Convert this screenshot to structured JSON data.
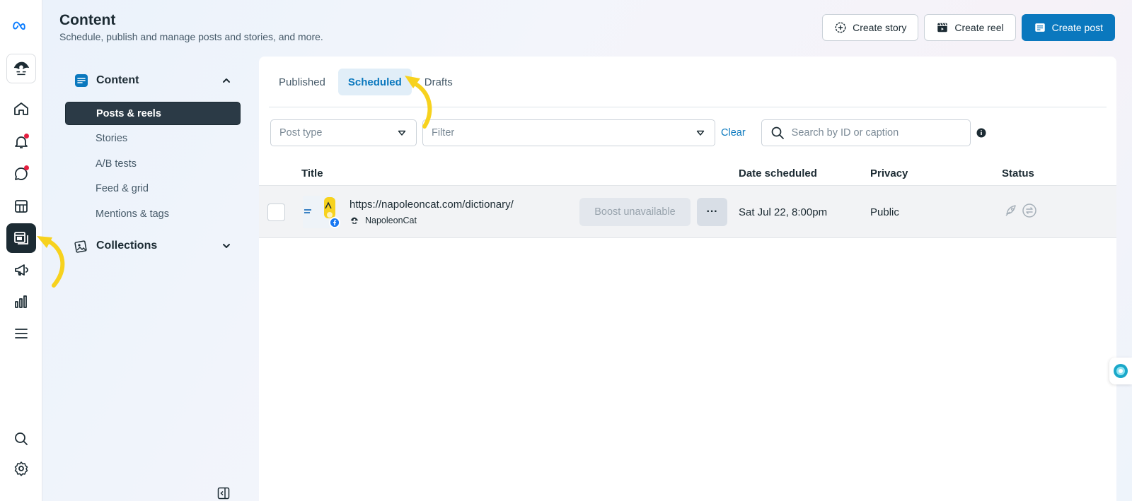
{
  "header": {
    "title": "Content",
    "subtitle": "Schedule, publish and manage posts and stories, and more.",
    "actions": [
      {
        "label": "Create story",
        "icon": "plus-circle-icon"
      },
      {
        "label": "Create reel",
        "icon": "reel-icon"
      },
      {
        "label": "Create post",
        "icon": "post-icon"
      }
    ]
  },
  "rail": {
    "logo": "meta-logo-icon",
    "avatar": "napoleoncat-avatar",
    "items": [
      {
        "name": "home-icon"
      },
      {
        "name": "bell-icon",
        "badge": true
      },
      {
        "name": "chat-icon",
        "badge": true
      },
      {
        "name": "table-icon"
      },
      {
        "name": "content-icon",
        "active": true
      },
      {
        "name": "megaphone-icon"
      },
      {
        "name": "insights-icon"
      },
      {
        "name": "menu-icon"
      },
      {
        "name": "search-icon"
      },
      {
        "name": "settings-icon"
      }
    ]
  },
  "subnav": {
    "content_section": "Content",
    "items": [
      "Posts & reels",
      "Stories",
      "A/B tests",
      "Feed & grid",
      "Mentions & tags"
    ],
    "active_item": "Posts & reels",
    "collections_section": "Collections"
  },
  "tabs": [
    "Published",
    "Scheduled",
    "Drafts"
  ],
  "active_tab": "Scheduled",
  "filters": {
    "post_type_placeholder": "Post type",
    "filter_placeholder": "Filter",
    "clear_label": "Clear",
    "search_placeholder": "Search by ID or caption"
  },
  "table": {
    "columns": [
      "Title",
      "Date scheduled",
      "Privacy",
      "Status"
    ],
    "rows": [
      {
        "title": "https://napoleoncat.com/dictionary/",
        "account": "NapoleonCat",
        "boost_label": "Boost unavailable",
        "more_label": "···",
        "date": "Sat Jul 22, 8:00pm",
        "privacy": "Public"
      }
    ]
  },
  "colors": {
    "accent": "#0a78be",
    "annotation": "#f7d21e",
    "active_nav": "#2b3a46"
  }
}
